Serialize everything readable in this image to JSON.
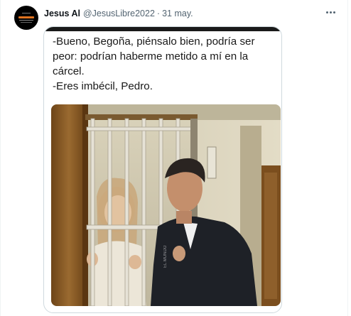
{
  "tweet": {
    "author_name": "Jesus Al",
    "author_handle": "@JesusLibre2022",
    "separator": "·",
    "date": "31 may.",
    "avatar_icon": "profile-avatar",
    "more_icon": "more-options-icon"
  },
  "image_card": {
    "caption_lines": [
      "-Bueno, Begoña, piénsalo bien, podría ser",
      "peor: podrían haberme metido a mí en la",
      "cárcel.",
      "-Eres imbécil, Pedro."
    ],
    "photo_alt": "photo-prison-cell-bars"
  },
  "colors": {
    "text_primary": "#0f1419",
    "text_secondary": "#536471",
    "border": "#cfd9de",
    "door_wood": "#8a5a24",
    "wall": "#dcd6c2"
  }
}
